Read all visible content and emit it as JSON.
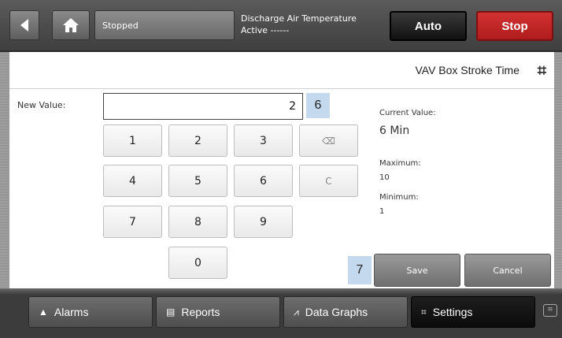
{
  "topbar": {
    "back_icon": "chevron-left-icon",
    "home_icon": "home-icon",
    "status": "Stopped",
    "point_name": "Discharge Air Temperature",
    "point_status": "Active ------",
    "auto_label": "Auto",
    "stop_label": "Stop"
  },
  "panel": {
    "title": "VAV Box Stroke Time",
    "new_value_label": "New Value:",
    "new_value": "2",
    "callout_input": "6",
    "callout_save": "7",
    "keys": [
      "1",
      "2",
      "3",
      "4",
      "5",
      "6",
      "7",
      "8",
      "9",
      "0"
    ],
    "backspace_glyph": "⌫",
    "clear_label": "C",
    "current_value_label": "Current Value:",
    "current_value": "6 Min",
    "maximum_label": "Maximum:",
    "maximum": "10",
    "minimum_label": "Minimum:",
    "minimum": "1",
    "save_label": "Save",
    "cancel_label": "Cancel"
  },
  "bottombar": {
    "tabs": [
      {
        "label": "Alarms",
        "icon": "bell-icon"
      },
      {
        "label": "Reports",
        "icon": "document-icon"
      },
      {
        "label": "Data Graphs",
        "icon": "graph-icon"
      },
      {
        "label": "Settings",
        "icon": "settings-icon"
      }
    ]
  },
  "colors": {
    "stop": "#c62828",
    "callout": "#c5d9ee"
  }
}
